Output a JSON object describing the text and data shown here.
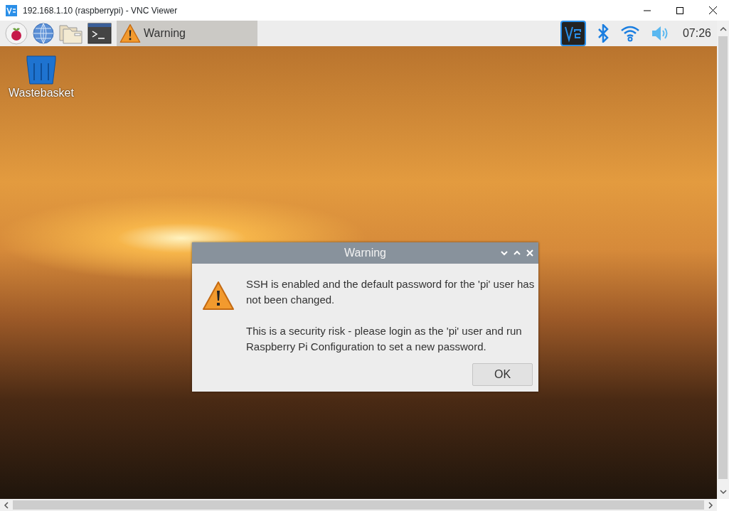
{
  "window": {
    "title": "192.168.1.10 (raspberrypi) - VNC Viewer"
  },
  "panel": {
    "tasks": [
      {
        "label": "Warning",
        "selected": true
      }
    ],
    "clock": "07:26"
  },
  "desktop": {
    "icons": [
      {
        "label": "Wastebasket"
      }
    ]
  },
  "dialog": {
    "title": "Warning",
    "message": [
      "SSH is enabled and the default password for the 'pi' user has not been changed.",
      "This is a security risk - please login as the 'pi' user and run Raspberry Pi Configuration to set a new password."
    ],
    "buttons": [
      "OK"
    ]
  }
}
